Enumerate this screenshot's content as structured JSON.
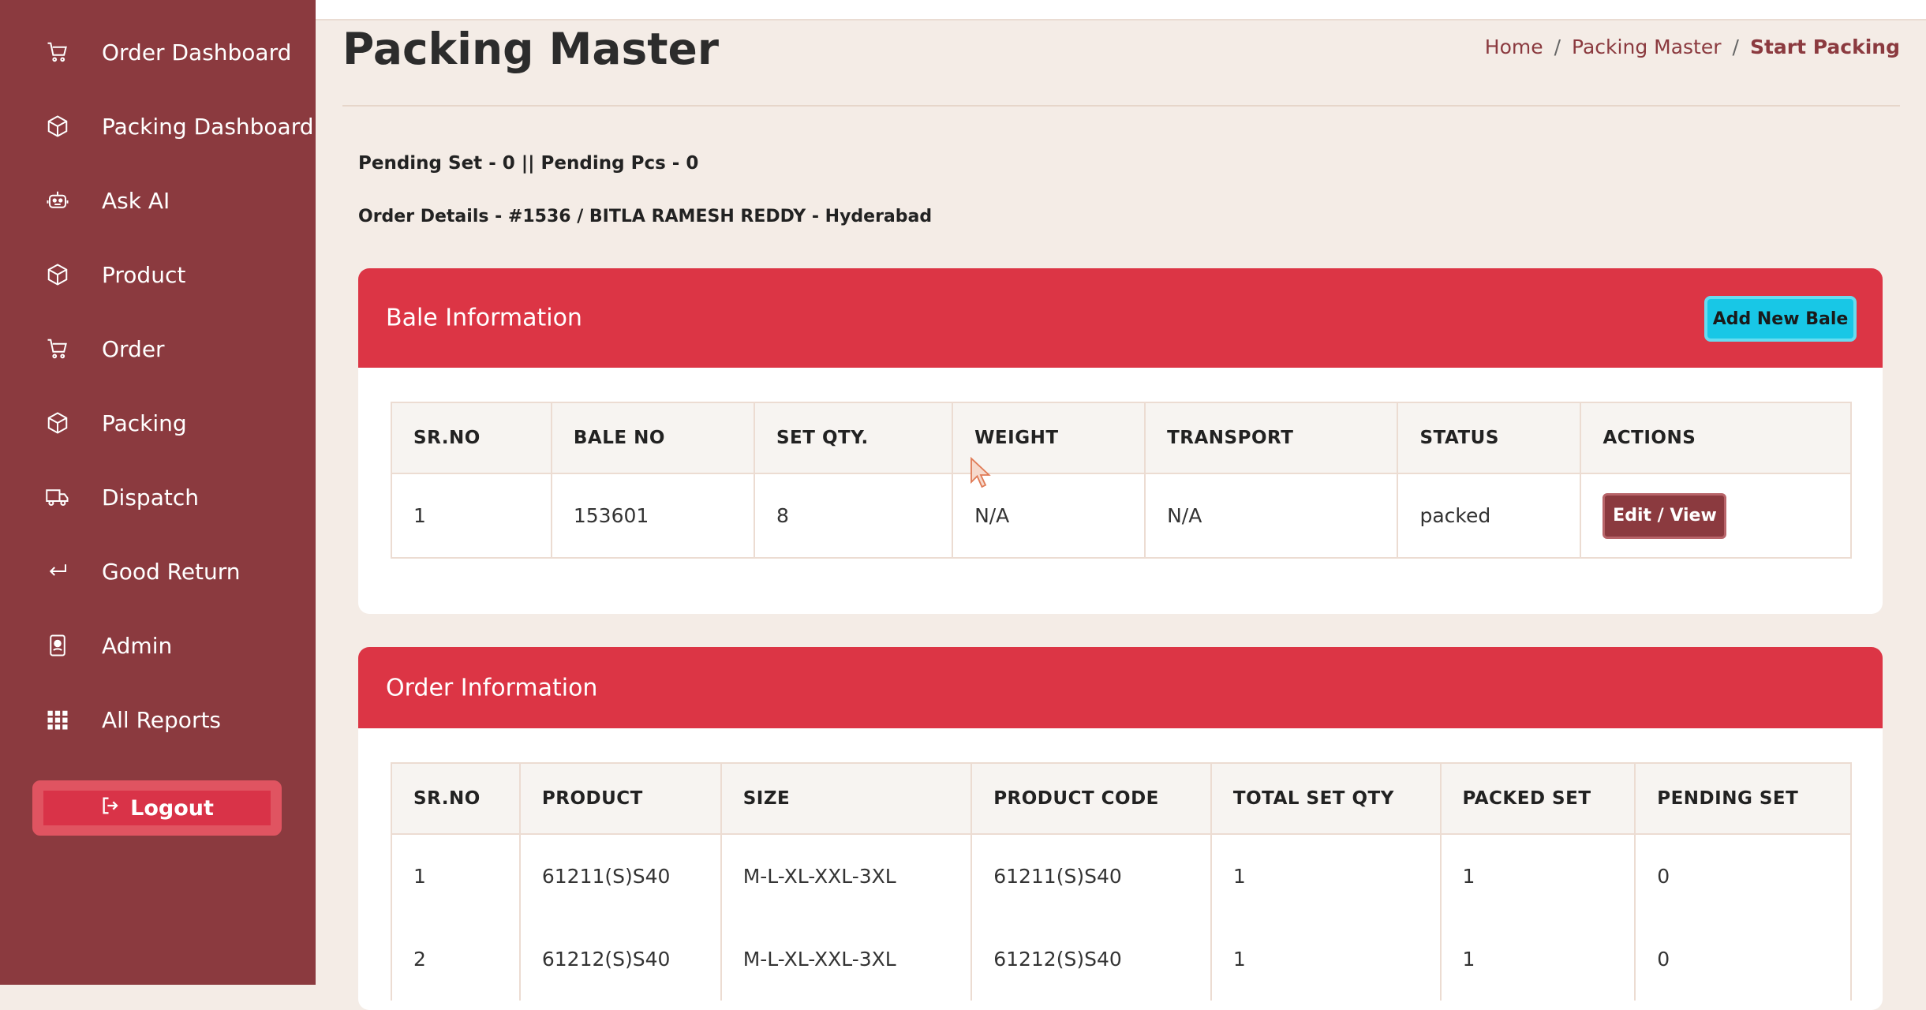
{
  "sidebar": {
    "items": [
      {
        "label": "Order Dashboard",
        "icon": "cart-icon"
      },
      {
        "label": "Packing Dashboard",
        "icon": "box-icon"
      },
      {
        "label": "Ask AI",
        "icon": "robot-icon"
      },
      {
        "label": "Product",
        "icon": "box-icon"
      },
      {
        "label": "Order",
        "icon": "cart-icon"
      },
      {
        "label": "Packing",
        "icon": "box-icon"
      },
      {
        "label": "Dispatch",
        "icon": "truck-icon"
      },
      {
        "label": "Good Return",
        "icon": "return-arrow-icon"
      },
      {
        "label": "Admin",
        "icon": "badge-icon"
      },
      {
        "label": "All Reports",
        "icon": "grid-icon"
      }
    ],
    "logout_label": "Logout"
  },
  "header": {
    "title": "Packing Master",
    "breadcrumb": [
      "Home",
      "Packing Master",
      "Start Packing"
    ]
  },
  "summary": {
    "pending": "Pending Set - 0 || Pending Pcs - 0",
    "order_details": "Order Details - #1536 / BITLA RAMESH REDDY - Hyderabad"
  },
  "bale": {
    "title": "Bale Information",
    "add_button": "Add New Bale",
    "columns": [
      "SR.NO",
      "BALE NO",
      "SET QTY.",
      "WEIGHT",
      "TRANSPORT",
      "STATUS",
      "ACTIONS"
    ],
    "rows": [
      {
        "sr": "1",
        "bale_no": "153601",
        "set_qty": "8",
        "weight": "N/A",
        "transport": "N/A",
        "status": "packed",
        "action": "Edit / View"
      }
    ]
  },
  "order": {
    "title": "Order Information",
    "columns": [
      "SR.NO",
      "PRODUCT",
      "SIZE",
      "PRODUCT CODE",
      "TOTAL SET QTY",
      "PACKED SET",
      "PENDING SET"
    ],
    "rows": [
      [
        "1",
        "61211(S)S40",
        "M-L-XL-XXL-3XL",
        "61211(S)S40",
        "1",
        "1",
        "0"
      ],
      [
        "2",
        "61212(S)S40",
        "M-L-XL-XXL-3XL",
        "61212(S)S40",
        "1",
        "1",
        "0"
      ]
    ]
  },
  "colors": {
    "sidebar": "#8b3a3f",
    "accent": "#dc3545",
    "info_button": "#18c7e6"
  }
}
